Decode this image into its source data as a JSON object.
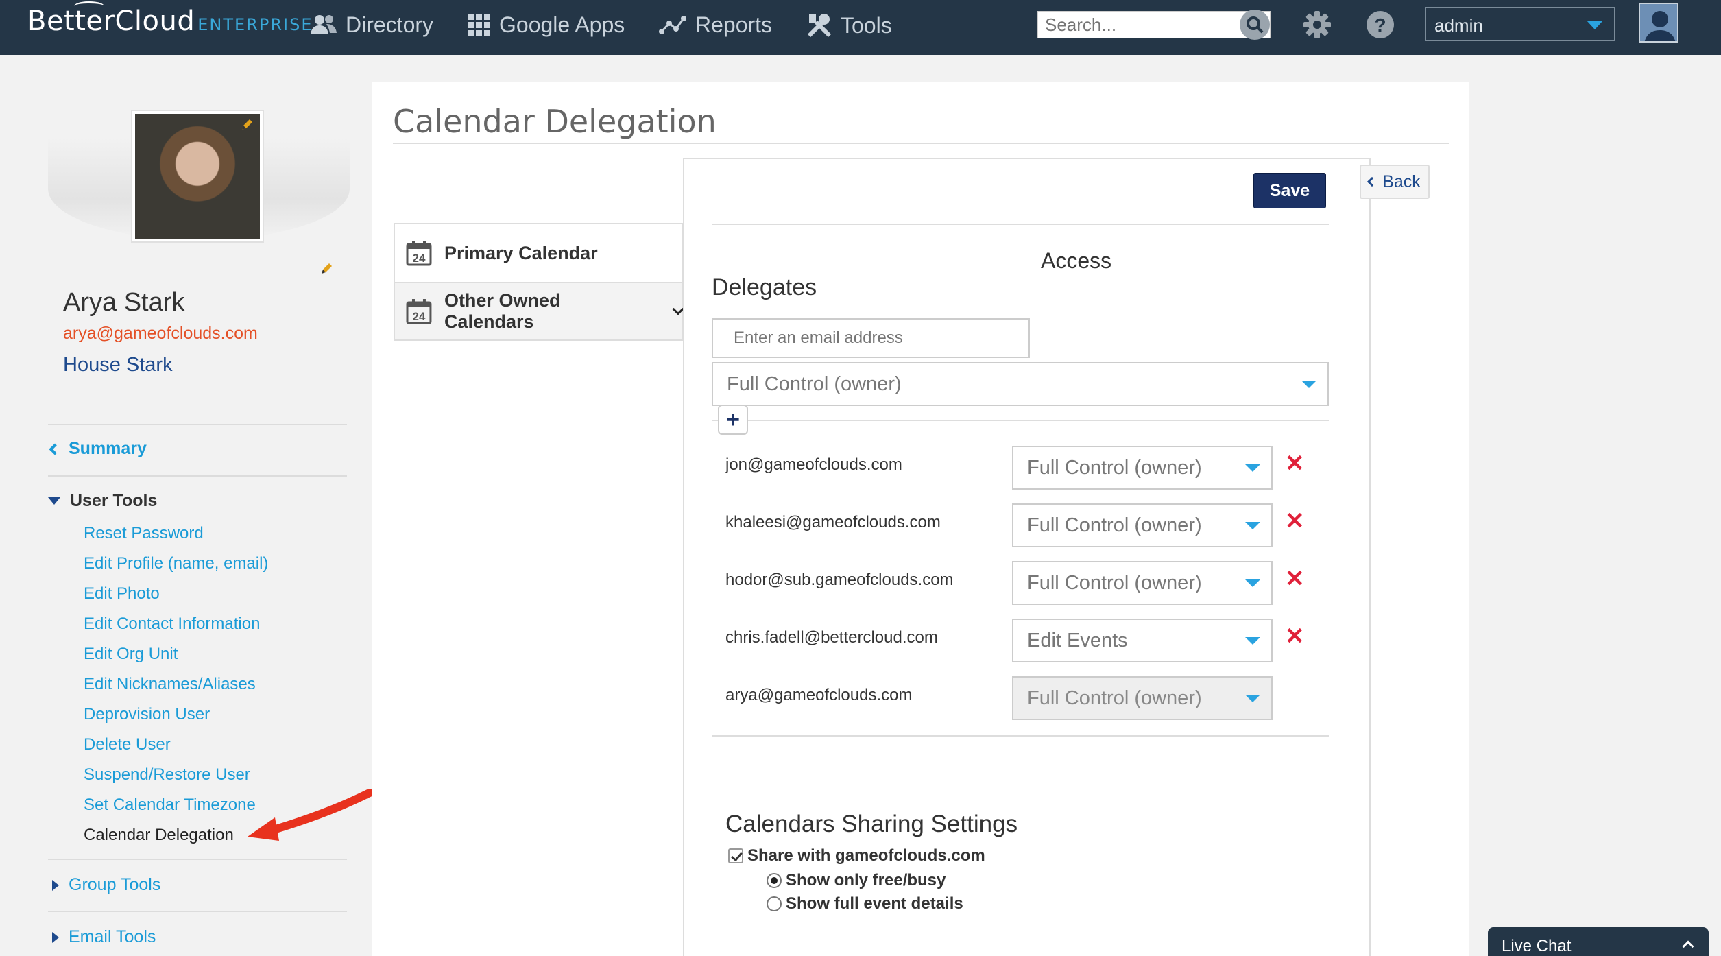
{
  "app": {
    "logo": "BetterCloud",
    "logo_suffix": "ENTERPRISE"
  },
  "nav": {
    "items": [
      {
        "label": "Directory",
        "icon": "users-icon"
      },
      {
        "label": "Google Apps",
        "icon": "grid-icon"
      },
      {
        "label": "Reports",
        "icon": "chart-nodes-icon"
      },
      {
        "label": "Tools",
        "icon": "tools-icon"
      }
    ],
    "search_placeholder": "Search...",
    "account": "admin"
  },
  "user": {
    "name": "Arya Stark",
    "email": "arya@gameofclouds.com",
    "org": "House Stark"
  },
  "sidebar": {
    "summary": "Summary",
    "user_tools": "User Tools",
    "links": [
      "Reset Password",
      "Edit Profile (name, email)",
      "Edit Photo",
      "Edit Contact Information",
      "Edit Org Unit",
      "Edit Nicknames/Aliases",
      "Deprovision User",
      "Delete User",
      "Suspend/Restore User",
      "Set Calendar Timezone",
      "Calendar Delegation"
    ],
    "group_tools": "Group Tools",
    "email_tools": "Email Tools"
  },
  "page": {
    "title": "Calendar Delegation",
    "calendar_tabs": [
      "Primary Calendar",
      "Other Owned Calendars"
    ],
    "calendar_icon_day": "24",
    "save": "Save",
    "back": "Back",
    "access": "Access",
    "delegates": "Delegates",
    "email_placeholder": "Enter an email address",
    "default_permission": "Full Control (owner)",
    "add": "+",
    "delegate_list": [
      {
        "email": "jon@gameofclouds.com",
        "permission": "Full Control (owner)",
        "removable": true
      },
      {
        "email": "khaleesi@gameofclouds.com",
        "permission": "Full Control (owner)",
        "removable": true
      },
      {
        "email": "hodor@sub.gameofclouds.com",
        "permission": "Full Control (owner)",
        "removable": true
      },
      {
        "email": "chris.fadell@bettercloud.com",
        "permission": "Edit Events",
        "removable": true
      },
      {
        "email": "arya@gameofclouds.com",
        "permission": "Full Control (owner)",
        "removable": false
      }
    ],
    "remove_symbol": "✕",
    "sharing_title": "Calendars Sharing Settings",
    "share_domain": "Share with gameofclouds.com",
    "share_options": [
      "Show only free/busy",
      "Show full event details"
    ]
  },
  "live_chat": "Live Chat",
  "colors": {
    "topbar": "#243647",
    "link": "#1a9bd7",
    "accent_caret": "#2aa3e0",
    "save": "#1c3266",
    "remove": "#e0213a",
    "email": "#e45026"
  }
}
